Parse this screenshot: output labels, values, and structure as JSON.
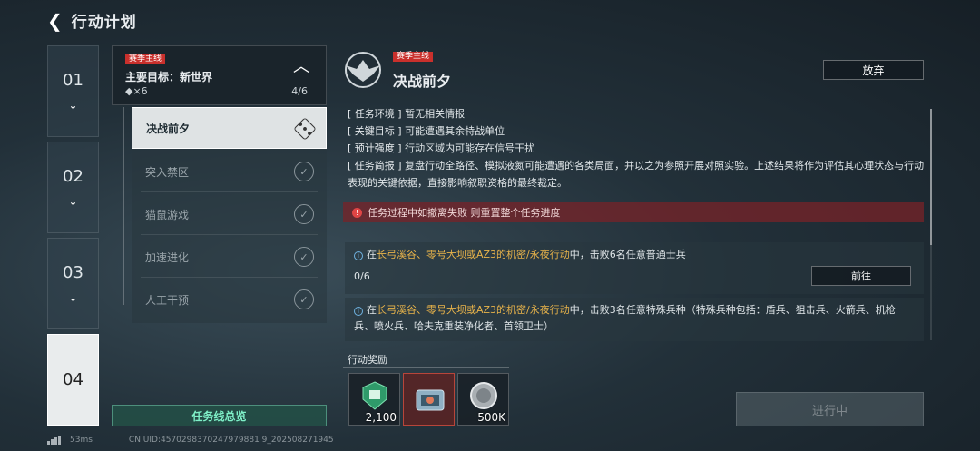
{
  "header": {
    "title": "行动计划"
  },
  "stages": [
    {
      "num": "01",
      "chevron": "⌄"
    },
    {
      "num": "02",
      "chevron": "⌄"
    },
    {
      "num": "03",
      "chevron": "⌄"
    },
    {
      "num": "04"
    }
  ],
  "objective": {
    "tag": "赛季主线",
    "title": "主要目标：新世界",
    "reward": "◆×6",
    "progress": "4/6",
    "caret": "︿"
  },
  "missions": [
    {
      "label": "决战前夕",
      "icon": "•••"
    },
    {
      "label": "突入禁区",
      "icon": "✓"
    },
    {
      "label": "猫鼠游戏",
      "icon": "✓"
    },
    {
      "label": "加速进化",
      "icon": "✓"
    },
    {
      "label": "人工干预",
      "icon": "✓"
    }
  ],
  "overview_label": "任务线总览",
  "detail": {
    "tag": "赛季主线",
    "title": "决战前夕",
    "abandon": "放弃",
    "info": [
      {
        "key": "[ 任务环境 ]",
        "val": "暂无相关情报"
      },
      {
        "key": "[ 关键目标 ]",
        "val": "可能遭遇其余特战单位"
      },
      {
        "key": "[ 预计强度 ]",
        "val": "行动区域内可能存在信号干扰"
      },
      {
        "key": "[ 任务简报 ]",
        "val": "复盘行动全路径、模拟液氮可能遭遇的各类局面，并以之为参照开展对照实验。上述结果将作为评估其心理状态与行动表现的关键依据，直接影响叙职资格的最终裁定。"
      }
    ],
    "warning": "任务过程中如撤离失败 则重置整个任务进度",
    "tasks": [
      {
        "pre": "在",
        "hl": "长弓溪谷、零号大坝或AZ3的机密/永夜行动",
        "post": "中，击败6名任意普通士兵",
        "progress": "0/6",
        "button": "前往"
      },
      {
        "pre": "在",
        "hl": "长弓溪谷、零号大坝或AZ3的机密/永夜行动",
        "post": "中，击败3名任意特殊兵种（特殊兵种包括：盾兵、狙击兵、火箭兵、机枪兵、喷火兵、哈夫克重装净化者、首领卫士）"
      }
    ]
  },
  "rewards": {
    "label": "行动奖励",
    "items": [
      {
        "icon": "green-badge-icon",
        "count": "2,100"
      },
      {
        "icon": "device-crate-icon",
        "count": ""
      },
      {
        "icon": "silver-coin-icon",
        "count": "500K"
      }
    ]
  },
  "status_button": "进行中",
  "footer": {
    "ping": "53ms",
    "uid": "CN UID:4570298370247979881 9_202508271945"
  }
}
